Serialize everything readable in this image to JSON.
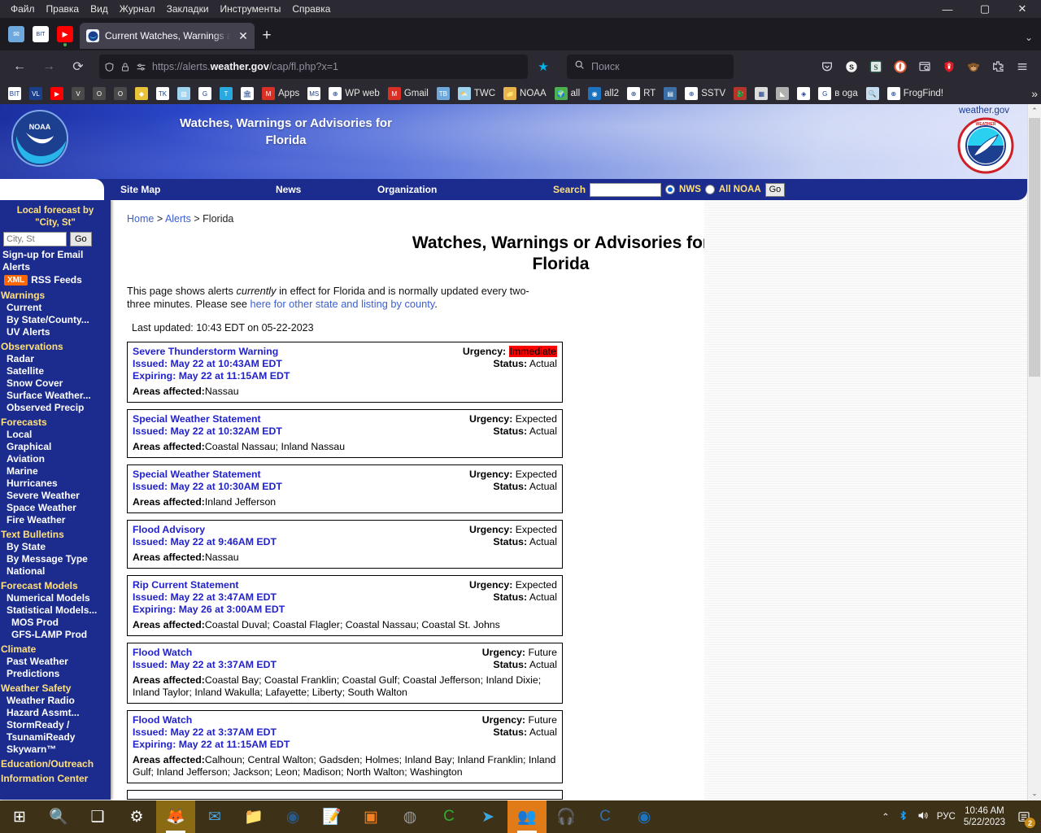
{
  "browser": {
    "menus": [
      "Файл",
      "Правка",
      "Вид",
      "Журнал",
      "Закладки",
      "Инструменты",
      "Справка"
    ],
    "window_controls": {
      "minimize": "—",
      "maximize": "▢",
      "close": "✕"
    },
    "quick_icons": [
      {
        "name": "thunderbird-taskbar-icon",
        "label": "TB"
      },
      {
        "name": "bitview-icon",
        "label": "BIT"
      },
      {
        "name": "youtube-icon",
        "label": "▶"
      }
    ],
    "tab": {
      "title": "Current Watches, Warnings and",
      "close": "✕",
      "favicon": "noaa-favicon"
    },
    "new_tab": "+",
    "tab_list_chevron": "⌄",
    "nav": {
      "back": "←",
      "forward": "→",
      "reload": "⟳"
    },
    "url": {
      "prefix": "https://alerts.",
      "domain": "weather.gov",
      "path": "/cap/fl.php?x=1"
    },
    "url_icons": [
      "shield-icon",
      "lock-icon",
      "permissions-icon"
    ],
    "bookmark_star": "★",
    "search": {
      "placeholder": "Поиск",
      "icon": "search-icon"
    },
    "toolbar_icons": [
      {
        "name": "pocket-icon",
        "glyph": "⌄"
      },
      {
        "name": "s-extension-icon",
        "glyph": "S"
      },
      {
        "name": "simplify-extension-icon",
        "glyph": "S"
      },
      {
        "name": "duckduckgo-privacy-icon",
        "glyph": "◑"
      },
      {
        "name": "screenshot-extension-icon",
        "glyph": "▣"
      },
      {
        "name": "password-manager-icon",
        "glyph": "🔒"
      },
      {
        "name": "monkey-extension-icon",
        "glyph": "🐵"
      },
      {
        "name": "extensions-icon",
        "glyph": "⟓"
      },
      {
        "name": "app-menu-icon",
        "glyph": "☰"
      }
    ],
    "bookmarks": [
      {
        "label": "",
        "icon": "bitview-icon",
        "glyph": "BIT",
        "color": "#ffffff"
      },
      {
        "label": "",
        "icon": "vl-icon",
        "glyph": "VL",
        "color": "#1b3f8b"
      },
      {
        "label": "",
        "icon": "youtube-icon",
        "glyph": "▶",
        "color": "#ff0000"
      },
      {
        "label": "",
        "icon": "v-icon",
        "glyph": "V",
        "color": "#4a4a4a"
      },
      {
        "label": "",
        "icon": "o-icon",
        "glyph": "O",
        "color": "#4a4a4a"
      },
      {
        "label": "",
        "icon": "o2-icon",
        "glyph": "O",
        "color": "#4a4a4a"
      },
      {
        "label": "",
        "icon": "hazard-icon",
        "glyph": "◆",
        "color": "#e8c33a"
      },
      {
        "label": "",
        "icon": "tinkercad-icon",
        "glyph": "TK",
        "color": "#ffffff"
      },
      {
        "label": "",
        "icon": "image-icon",
        "glyph": "▨",
        "color": "#9fd3ef"
      },
      {
        "label": "",
        "icon": "google-icon",
        "glyph": "G",
        "color": "#ffffff"
      },
      {
        "label": "",
        "icon": "telegram-t-icon",
        "glyph": "T",
        "color": "#2aa8e0"
      },
      {
        "label": "",
        "icon": "archive-icon",
        "glyph": "🏛",
        "color": "#ffffff"
      },
      {
        "label": "Apps",
        "icon": "gmail-apps-icon",
        "glyph": "M",
        "color": "#d93025"
      },
      {
        "label": "",
        "icon": "msdo-icon",
        "glyph": "MS",
        "color": "#ffffff"
      },
      {
        "label": "WP web",
        "icon": "globe-icon",
        "glyph": "⊕",
        "color": "#ffffff"
      },
      {
        "label": "Gmail",
        "icon": "gmail-icon",
        "glyph": "M",
        "color": "#d93025"
      },
      {
        "label": "",
        "icon": "thunderbird-icon",
        "glyph": "TB",
        "color": "#6fa8dc"
      },
      {
        "label": "TWC",
        "icon": "twc-icon",
        "glyph": "⛅",
        "color": "#9fd3ef"
      },
      {
        "label": "NOAA",
        "icon": "folder-icon",
        "glyph": "📁",
        "color": "#e9b44c"
      },
      {
        "label": "all",
        "icon": "globe-green-icon",
        "glyph": "🌍",
        "color": "#4caf50"
      },
      {
        "label": "all2",
        "icon": "noaa-icon",
        "glyph": "◉",
        "color": "#1e73be"
      },
      {
        "label": "RT",
        "icon": "globe-icon",
        "glyph": "⊕",
        "color": "#ffffff"
      },
      {
        "label": "",
        "icon": "document-icon",
        "glyph": "▤",
        "color": "#3a6ea5"
      },
      {
        "label": "SSTV",
        "icon": "globe-icon",
        "glyph": "⊕",
        "color": "#ffffff"
      },
      {
        "label": "",
        "icon": "dragon-icon",
        "glyph": "🐉",
        "color": "#b5342b"
      },
      {
        "label": "",
        "icon": "calculator-icon",
        "glyph": "▦",
        "color": "#dddddd"
      },
      {
        "label": "",
        "icon": "mountain-icon",
        "glyph": "◣",
        "color": "#b0b0b0"
      },
      {
        "label": "",
        "icon": "pattern-icon",
        "glyph": "◈",
        "color": "#ffffff"
      },
      {
        "label": "в oga",
        "icon": "google-g-icon",
        "glyph": "G",
        "color": "#ffffff"
      },
      {
        "label": "",
        "icon": "magnifier-icon",
        "glyph": "🔍",
        "color": "#c8dcf0"
      },
      {
        "label": "FrogFind!",
        "icon": "globe-icon",
        "glyph": "⊕",
        "color": "#ffffff"
      }
    ],
    "bookmarks_overflow": "»"
  },
  "site": {
    "banner_title_line1": "Watches, Warnings or Advisories for",
    "banner_title_line2": "Florida",
    "weather_gov": "weather.gov",
    "noaa_logo_text": "NOAA",
    "nws_logo_text": "NATIONAL WEATHER SERVICE",
    "nav": {
      "site_map": "Site Map",
      "news": "News",
      "organization": "Organization",
      "search_label": "Search",
      "search_value": "",
      "radio_nws": "NWS",
      "radio_all_noaa": "All NOAA",
      "go": "Go"
    }
  },
  "sidebar": {
    "local_forecast_head_line1": "Local forecast by",
    "local_forecast_head_line2": "\"City, St\"",
    "city_placeholder": "City, St",
    "go_label": "Go",
    "email_alerts": "Sign-up for Email Alerts",
    "xml_badge": "XML",
    "rss_feeds": "RSS Feeds",
    "sections": [
      {
        "group": "Warnings",
        "items": [
          "Current",
          "By State/County...",
          "UV Alerts"
        ]
      },
      {
        "group": "Observations",
        "items": [
          "Radar",
          "Satellite",
          "Snow Cover",
          "Surface Weather...",
          "Observed Precip"
        ]
      },
      {
        "group": "Forecasts",
        "items": [
          "Local",
          "Graphical",
          "Aviation",
          "Marine",
          "Hurricanes",
          "Severe Weather",
          "Space Weather",
          "Fire Weather"
        ]
      },
      {
        "group": "Text Bulletins",
        "items": [
          "By State",
          "By Message Type",
          "National"
        ]
      },
      {
        "group": "Forecast Models",
        "items": [
          "Numerical Models",
          "Statistical Models...",
          "MOS Prod",
          "GFS-LAMP Prod"
        ]
      },
      {
        "group": "Climate",
        "items": [
          "Past Weather",
          "Predictions"
        ]
      },
      {
        "group": "Weather Safety",
        "items": [
          "Weather Radio",
          "Hazard Assmt...",
          "StormReady /",
          "TsunamiReady",
          "Skywarn™"
        ]
      },
      {
        "group": "Education/Outreach",
        "items": []
      },
      {
        "group": "Information Center",
        "items": []
      }
    ]
  },
  "main": {
    "breadcrumb": {
      "home": "Home",
      "sep1": ">",
      "alerts": "Alerts",
      "sep2": ">",
      "current": "Florida"
    },
    "title_line1": "Watches, Warnings or Advisories for",
    "title_line2": "Florida",
    "intro_a": "This page shows alerts ",
    "intro_italic": "currently",
    "intro_b": " in effect for Florida and is normally updated every two-three minutes. Please see ",
    "intro_link": "here for other state and listing by county",
    "intro_c": ".",
    "last_updated": "Last updated: 10:43 EDT on 05-22-2023",
    "labels": {
      "urgency": "Urgency:",
      "status": "Status:",
      "areas": "Areas affected:"
    },
    "alerts": [
      {
        "title": "Severe Thunderstorm Warning",
        "issued": "Issued: May 22 at 10:43AM EDT",
        "expiring": "Expiring: May 22 at 11:15AM EDT",
        "urgency": "Immediate",
        "urgency_highlight": true,
        "status": "Actual",
        "areas": "Nassau"
      },
      {
        "title": "Special Weather Statement",
        "issued": "Issued: May 22 at 10:32AM EDT",
        "expiring": "",
        "urgency": "Expected",
        "urgency_highlight": false,
        "status": "Actual",
        "areas": "Coastal Nassau; Inland Nassau"
      },
      {
        "title": "Special Weather Statement",
        "issued": "Issued: May 22 at 10:30AM EDT",
        "expiring": "",
        "urgency": "Expected",
        "urgency_highlight": false,
        "status": "Actual",
        "areas": "Inland Jefferson"
      },
      {
        "title": "Flood Advisory",
        "issued": "Issued: May 22 at 9:46AM EDT",
        "expiring": "",
        "urgency": "Expected",
        "urgency_highlight": false,
        "status": "Actual",
        "areas": "Nassau"
      },
      {
        "title": "Rip Current Statement",
        "issued": "Issued: May 22 at 3:47AM EDT",
        "expiring": "Expiring: May 26 at 3:00AM EDT",
        "urgency": "Expected",
        "urgency_highlight": false,
        "status": "Actual",
        "areas": "Coastal Duval; Coastal Flagler; Coastal Nassau; Coastal St. Johns"
      },
      {
        "title": "Flood Watch",
        "issued": "Issued: May 22 at 3:37AM EDT",
        "expiring": "",
        "urgency": "Future",
        "urgency_highlight": false,
        "status": "Actual",
        "areas": "Coastal Bay; Coastal Franklin; Coastal Gulf; Coastal Jefferson; Inland Dixie; Inland Taylor; Inland Wakulla; Lafayette; Liberty; South Walton"
      },
      {
        "title": "Flood Watch",
        "issued": "Issued: May 22 at 3:37AM EDT",
        "expiring": "Expiring: May 22 at 11:15AM EDT",
        "urgency": "Future",
        "urgency_highlight": false,
        "status": "Actual",
        "areas": "Calhoun; Central Walton; Gadsden; Holmes; Inland Bay; Inland Franklin; Inland Gulf; Inland Jefferson; Jackson; Leon; Madison; North Walton; Washington"
      }
    ]
  },
  "scrollbar": {
    "up": "⌃",
    "down": "⌄"
  },
  "taskbar": {
    "items": [
      {
        "name": "start-button",
        "glyph": "⊞",
        "color": "#ffffff"
      },
      {
        "name": "search-taskbar-icon",
        "glyph": "🔍",
        "color": "#ffffff"
      },
      {
        "name": "task-view-icon",
        "glyph": "❑",
        "color": "#ffffff"
      },
      {
        "name": "settings-gear-icon",
        "glyph": "⚙",
        "color": "#ffffff"
      },
      {
        "name": "firefox-taskbar-icon",
        "glyph": "🦊",
        "color": "#ff7139"
      },
      {
        "name": "thunderbird-taskbar-icon",
        "glyph": "✉",
        "color": "#4aa3df"
      },
      {
        "name": "file-explorer-icon",
        "glyph": "📁",
        "color": "#e9b44c"
      },
      {
        "name": "steam-icon",
        "glyph": "◉",
        "color": "#2a5a8a"
      },
      {
        "name": "notepad-editor-icon",
        "glyph": "📝",
        "color": "#7ecb7e"
      },
      {
        "name": "vmware-icon",
        "glyph": "▣",
        "color": "#f58220"
      },
      {
        "name": "obs-studio-icon",
        "glyph": "◍",
        "color": "#9a9a9a"
      },
      {
        "name": "calc-green-icon",
        "glyph": "C",
        "color": "#2fae2f"
      },
      {
        "name": "telegram-taskbar-icon",
        "glyph": "➤",
        "color": "#3aa8e0"
      },
      {
        "name": "people-icon",
        "glyph": "👥",
        "color": "#4aa3df"
      },
      {
        "name": "headphones-icon",
        "glyph": "🎧",
        "color": "#e0a030"
      },
      {
        "name": "calibre-icon",
        "glyph": "C",
        "color": "#2f6fae"
      },
      {
        "name": "nws-app-icon",
        "glyph": "◉",
        "color": "#1e73be"
      }
    ],
    "tray": {
      "chevron": "⌃",
      "bluetooth": "✦",
      "volume": "🔊",
      "language": "РУС",
      "time": "10:46 AM",
      "date": "5/22/2023",
      "notification_glyph": "▤",
      "notification_count": "2"
    }
  }
}
